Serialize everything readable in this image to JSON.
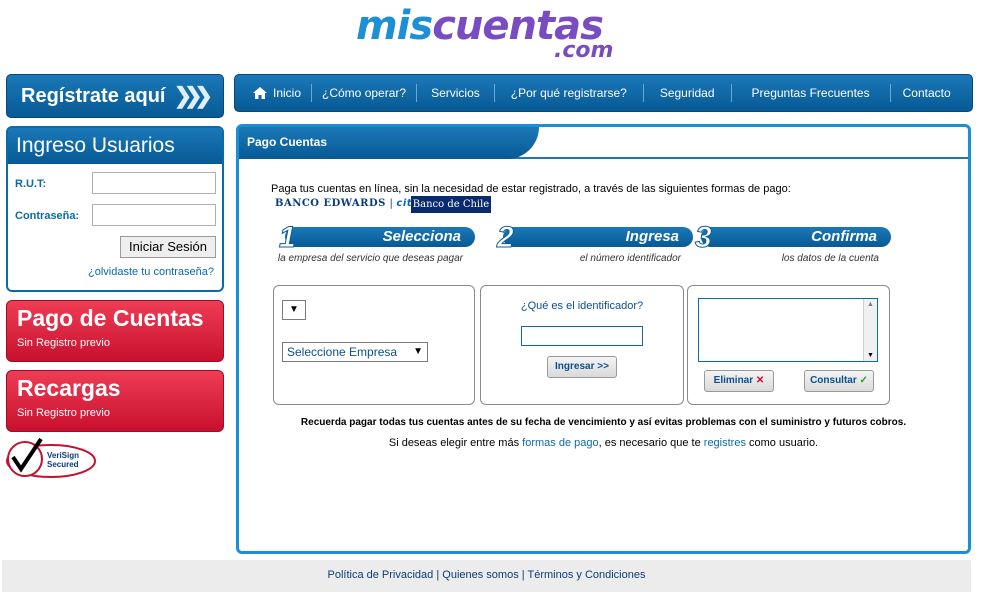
{
  "logo": {
    "part1": "mis",
    "part2": "cuentas",
    "part3": ".com"
  },
  "register_button": {
    "label": "Regístrate aquí"
  },
  "login": {
    "title": "Ingreso Usuarios",
    "rut_label": "R.U.T:",
    "password_label": "Contraseña:",
    "rut_value": "",
    "password_value": "",
    "submit_label": "Iniciar Sesión",
    "forgot_label": "¿olvidaste tu contraseña?"
  },
  "side_buttons": [
    {
      "title": "Pago de Cuentas",
      "subtitle": "Sin Registro previo"
    },
    {
      "title": "Recargas",
      "subtitle": "Sin Registro previo"
    }
  ],
  "verisign": {
    "line1": "VeriSign",
    "line2": "Secured"
  },
  "nav": {
    "items": [
      {
        "label": "Inicio",
        "icon": "home-icon"
      },
      {
        "label": "¿Cómo operar?"
      },
      {
        "label": "Servicios"
      },
      {
        "label": "¿Por qué registrarse?"
      },
      {
        "label": "Seguridad"
      },
      {
        "label": "Preguntas Frecuentes"
      },
      {
        "label": "Contacto"
      }
    ]
  },
  "main": {
    "title": "Pago Cuentas",
    "intro": "Paga tus cuentas en línea, sin la necesidad de estar registrado, a través de las siguientes formas de pago:",
    "bank1": "BANCO EDWARDS",
    "bank1_citi": "citi",
    "bank2": "Banco de Chile",
    "steps": [
      {
        "num": "1",
        "title": "Selecciona",
        "desc": "la empresa del servicio que deseas pagar"
      },
      {
        "num": "2",
        "title": "Ingresa",
        "desc": "el número identificador"
      },
      {
        "num": "3",
        "title": "Confirma",
        "desc": "los datos de la cuenta"
      }
    ],
    "panel1": {
      "small_select": "",
      "empresa_select": "Seleccione Empresa"
    },
    "panel2": {
      "question": "¿Qué es el identificador?",
      "input_value": "",
      "button": "Ingresar >>"
    },
    "panel3": {
      "delete_button": "Eliminar",
      "consult_button": "Consultar"
    },
    "notice": "Recuerda pagar todas tus cuentas antes de su fecha de vencimiento y así evitas problemas con el suministro y futuros cobros.",
    "notice2_pre": "Si deseas elegir entre más ",
    "notice2_link1": "formas de pago",
    "notice2_mid": ", es necesario que te ",
    "notice2_link2": "registres",
    "notice2_post": " como usuario."
  },
  "footer": {
    "links": [
      "Política de Privacidad",
      "Quienes somos",
      "Términos y Condiciones"
    ],
    "separator": " | "
  },
  "colors": {
    "primary_blue": "#1b78b8",
    "accent_red": "#c8102e",
    "link_blue": "#0b6aa8"
  }
}
